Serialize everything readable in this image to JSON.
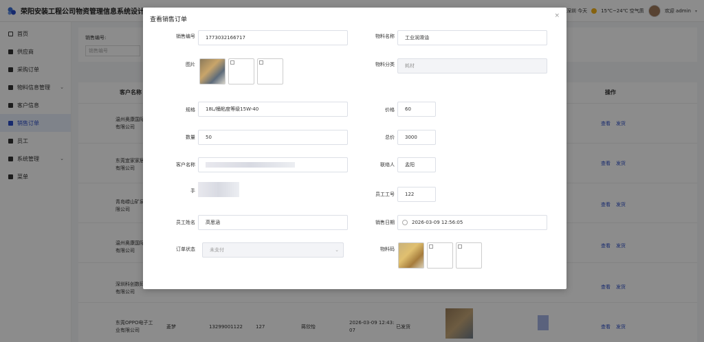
{
  "header": {
    "title": "荣阳安装工程公司物资管理信息系统设计与实",
    "weather": "深圳 今天",
    "temperature": "15℃~24℃ 空气质",
    "greeting": "欢迎 admin"
  },
  "sidebar": {
    "items": [
      {
        "label": "首页"
      },
      {
        "label": "供应商"
      },
      {
        "label": "采购订单"
      },
      {
        "label": "物料信息管理"
      },
      {
        "label": "客户信息"
      },
      {
        "label": "销售订单"
      },
      {
        "label": "员工"
      },
      {
        "label": "系统管理"
      },
      {
        "label": "菜单"
      }
    ]
  },
  "search": {
    "label": "销售编号:",
    "placeholder": "销售编号"
  },
  "table": {
    "headers": {
      "customer": "客户名称",
      "action": "操作"
    },
    "action_view": "查看",
    "action_ship": "发货",
    "rows": [
      {
        "customer": "温州奥康国际\n有限公司"
      },
      {
        "customer": "东莞宜家家居\n有限公司"
      },
      {
        "customer": "青岛崂山矿泉\n限公司"
      },
      {
        "customer": "温州奥康国际\n有限公司"
      },
      {
        "customer": "深圳科创数码\n有限公司"
      },
      {
        "customer": "东莞OPPO电子工\n业有限公司",
        "contact": "菱梦",
        "phone": "13299001122",
        "staff_no": "127",
        "staff_name": "蒋欣怡",
        "date": "2026-03-09 12:43:\n07",
        "status": "已发货"
      }
    ]
  },
  "modal": {
    "title": "查看销售订单",
    "close": "×",
    "fields": {
      "sale_no_label": "销售编号",
      "sale_no": "1773032166717",
      "material_name_label": "物料名称",
      "material_name": "工业润滑油",
      "image_label": "图片",
      "category_label": "物料分类",
      "category": "耗材",
      "spec_label": "规格",
      "spec": "18L/桶粘度等级15W-40",
      "price_label": "价格",
      "price": "60",
      "quantity_label": "数量",
      "quantity": "50",
      "total_label": "总价",
      "total": "3000",
      "customer_label": "客户名称",
      "contact_label": "联络人",
      "contact": "孟阳",
      "phone_label": "手",
      "staff_no_label": "员工工号",
      "staff_no": "122",
      "staff_name_label": "员工姓名",
      "staff_name": "高思涵",
      "sale_date_label": "销售日期",
      "sale_date": "2026-03-09 12:56:05",
      "order_status_label": "订单状态",
      "order_status": "未支付",
      "material_code_label": "物料码"
    }
  },
  "colors": {
    "primary": "#2a4dc8",
    "overlay": "rgba(0,0,0,0.45)",
    "sidebar_active_bg": "#e8eefc"
  },
  "icons": {
    "logo": "logo-icon",
    "weather": "sun-icon",
    "close": "close-icon"
  }
}
